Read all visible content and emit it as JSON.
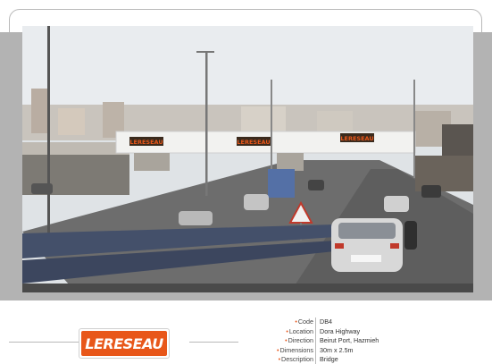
{
  "billboard": {
    "brand_logo_text": "LERESEAU",
    "sign_text": "LERESEAU",
    "car_plate": "",
    "specs": [
      {
        "label": "Code",
        "value": "DB4"
      },
      {
        "label": "Location",
        "value": "Dora Highway"
      },
      {
        "label": "Direction",
        "value": "Beirut Port, Hazmieh"
      },
      {
        "label": "Dimensions",
        "value": "30m x 2.5m"
      },
      {
        "label": "Description",
        "value": "Bridge"
      }
    ]
  },
  "colors": {
    "brand_orange": "#e8571a",
    "band_gray": "#b3b3b3",
    "frame_line": "#b9b9b9"
  }
}
